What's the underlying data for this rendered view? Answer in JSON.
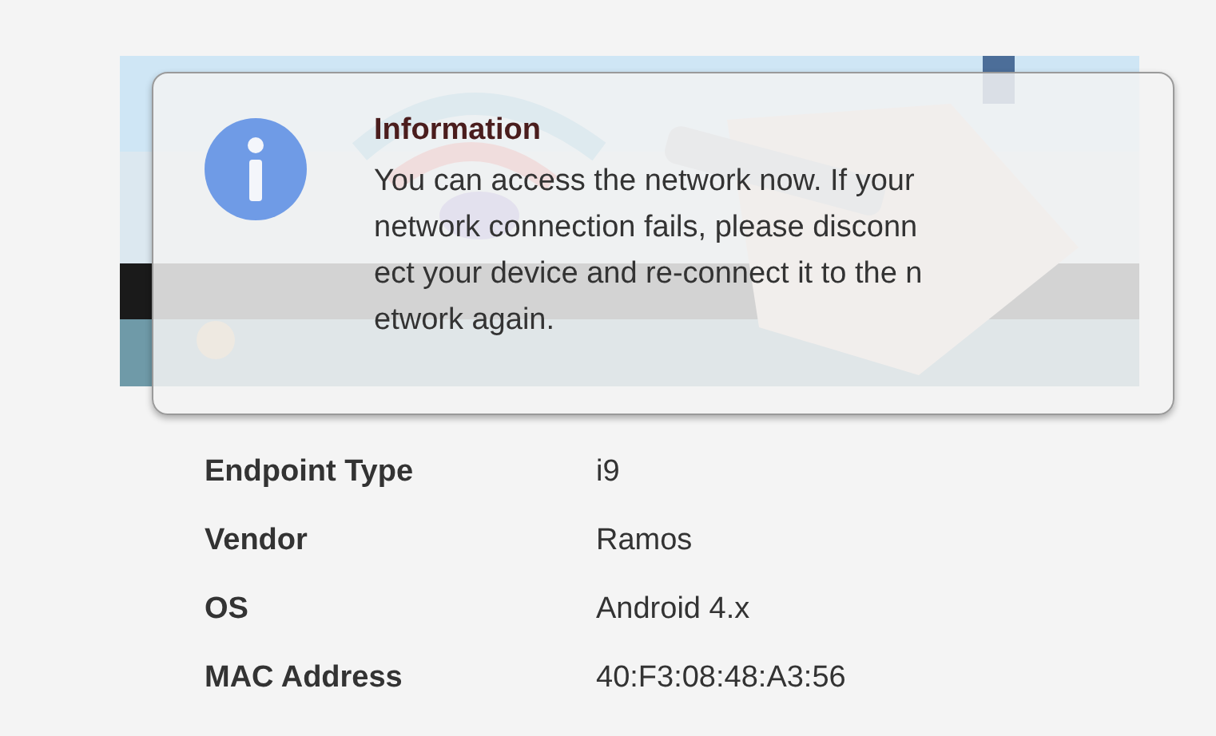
{
  "dialog": {
    "title": "Information",
    "message_lines": [
      "You can access the network now. If your",
      "network connection fails, please disconn",
      "ect your device and re-connect it to the n",
      "etwork again."
    ]
  },
  "details": [
    {
      "label": "Endpoint Type",
      "value": "i9"
    },
    {
      "label": "Vendor",
      "value": "Ramos"
    },
    {
      "label": "OS",
      "value": "Android 4.x"
    },
    {
      "label": "MAC Address",
      "value": "40:F3:08:48:A3:56"
    }
  ]
}
